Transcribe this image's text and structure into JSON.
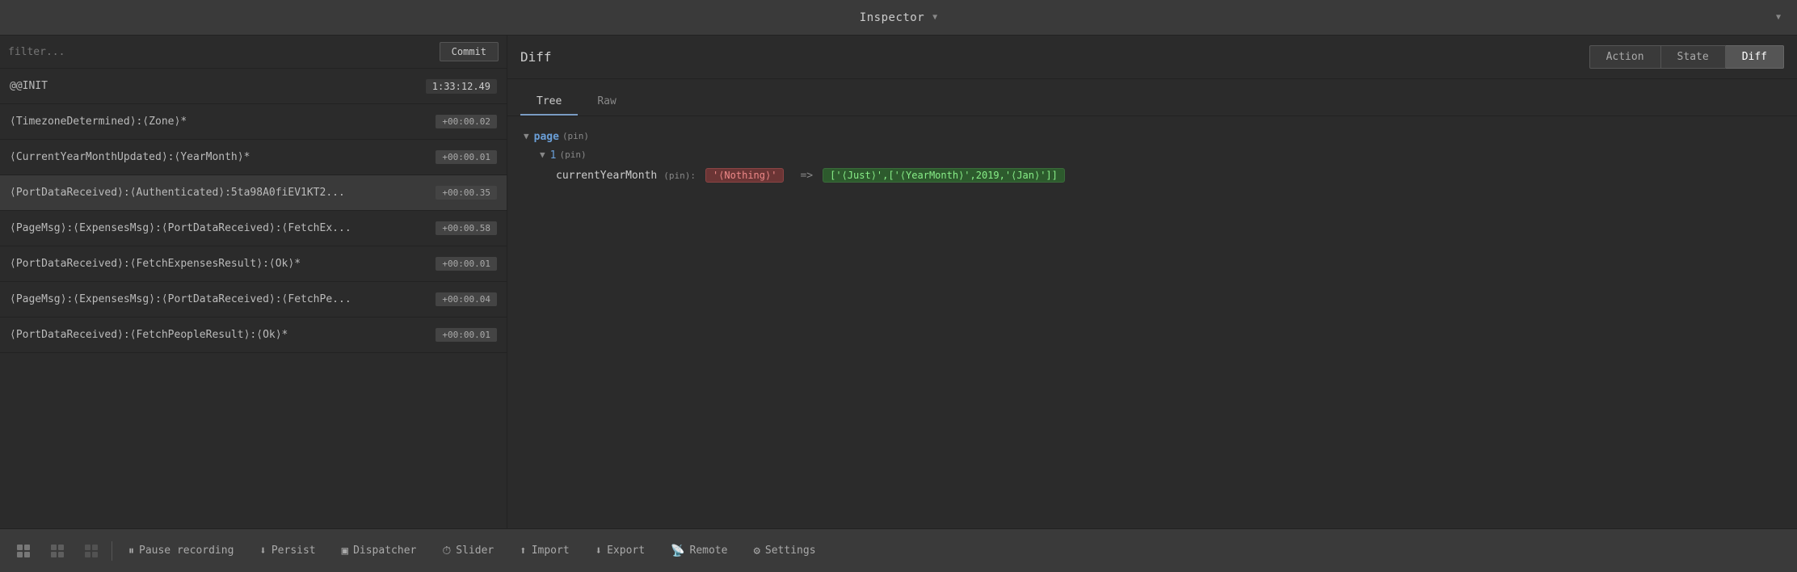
{
  "header": {
    "title": "Inspector",
    "chevron_down": "▼",
    "chevron_right": "▼"
  },
  "left_panel": {
    "filter_placeholder": "filter...",
    "commit_label": "Commit",
    "actions": [
      {
        "name": "@@INIT",
        "time": "1:33:12.49",
        "time_style": "large"
      },
      {
        "name": "⟨TimezoneDetermined⟩:⟨Zone⟩*",
        "time": "+00:00.02"
      },
      {
        "name": "⟨CurrentYearMonthUpdated⟩:⟨YearMonth⟩*",
        "time": "+00:00.01"
      },
      {
        "name": "⟨PortDataReceived⟩:⟨Authenticated⟩:5ta98A0fiEV1KT2...",
        "time": "+00:00.35"
      },
      {
        "name": "⟨PageMsg⟩:⟨ExpensesMsg⟩:⟨PortDataReceived⟩:⟨FetchEx...",
        "time": "+00:00.58"
      },
      {
        "name": "⟨PortDataReceived⟩:⟨FetchExpensesResult⟩:⟨Ok⟩*",
        "time": "+00:00.01"
      },
      {
        "name": "⟨PageMsg⟩:⟨ExpensesMsg⟩:⟨PortDataReceived⟩:⟨FetchPe...",
        "time": "+00:00.04"
      },
      {
        "name": "⟨PortDataReceived⟩:⟨FetchPeopleResult⟩:⟨Ok⟩*",
        "time": "+00:00.01"
      }
    ]
  },
  "right_panel": {
    "title": "Diff",
    "tab_buttons": [
      {
        "label": "Action",
        "active": false
      },
      {
        "label": "State",
        "active": false
      },
      {
        "label": "Diff",
        "active": true
      }
    ],
    "view_tabs": [
      {
        "label": "Tree",
        "active": true
      },
      {
        "label": "Raw",
        "active": false
      }
    ],
    "diff_tree": {
      "page_key": "page",
      "page_pin": "(pin)",
      "index_key": "1",
      "index_pin": "(pin)",
      "prop_key": "currentYearMonth",
      "prop_pin": "(pin):",
      "old_value": "'⟨Nothing⟩'",
      "arrow": "=>",
      "new_value": "['⟨Just⟩',['⟨YearMonth⟩',2019,'⟨Jan⟩']]"
    }
  },
  "toolbar": {
    "icon1": "⊞",
    "icon2": "⊟",
    "icon3": "⊠",
    "pause_icon": "⏸",
    "pause_label": "Pause recording",
    "persist_icon": "⬇",
    "persist_label": "Persist",
    "dispatcher_icon": "▣",
    "dispatcher_label": "Dispatcher",
    "slider_icon": "⏱",
    "slider_label": "Slider",
    "import_icon": "⬆",
    "import_label": "Import",
    "export_icon": "⬇",
    "export_label": "Export",
    "remote_icon": "📡",
    "remote_label": "Remote",
    "settings_icon": "⚙",
    "settings_label": "Settings"
  }
}
